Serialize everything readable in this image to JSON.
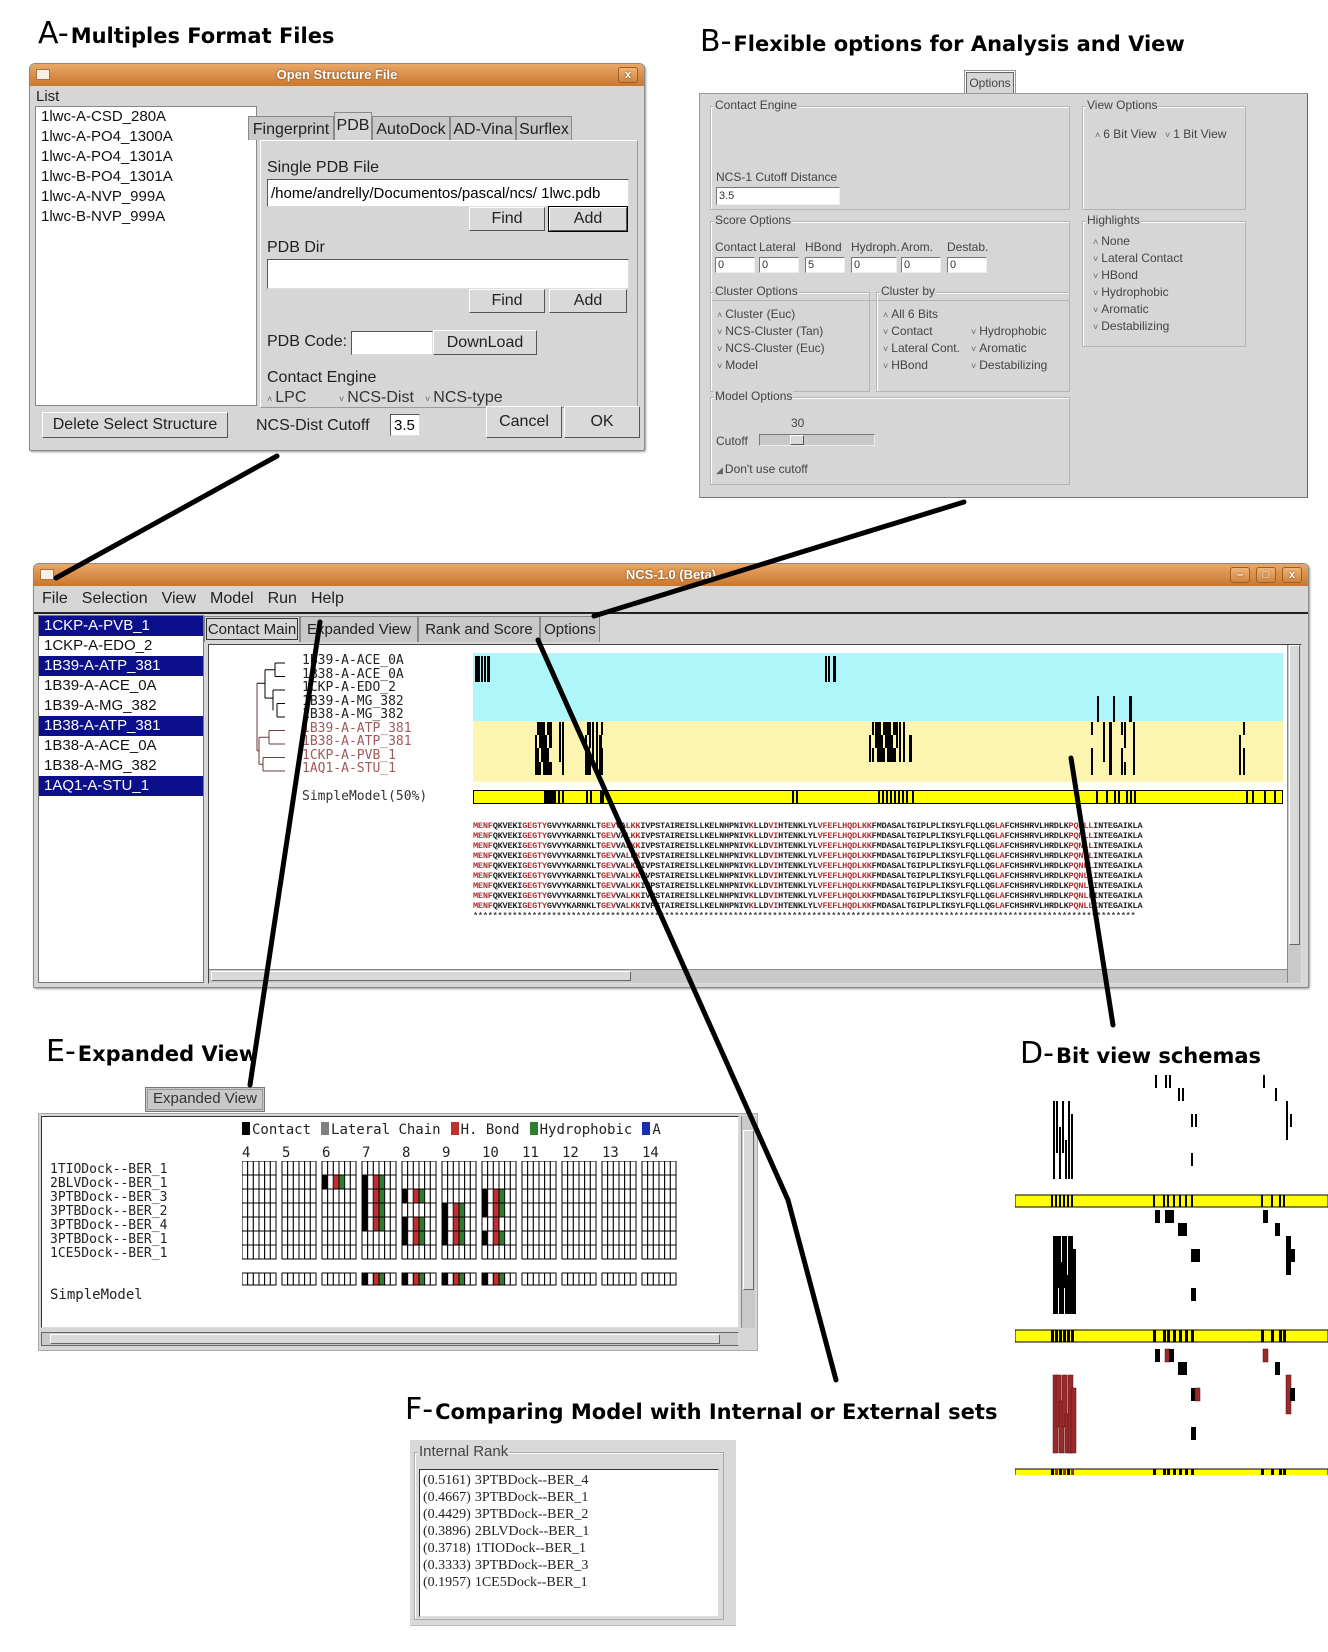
{
  "sections": {
    "A": {
      "letter": "A-",
      "title": "Multiples Format Files"
    },
    "B": {
      "letter": "B-",
      "title": "Flexible options for Analysis and View"
    },
    "D": {
      "letter": "D-",
      "title": "Bit view schemas"
    },
    "E": {
      "letter": "E-",
      "title": "Expanded View"
    },
    "F": {
      "letter": "F-",
      "title": "Comparing Model with Internal or External sets"
    }
  },
  "open_dialog": {
    "title": "Open Structure File",
    "close_glyph": "x",
    "list_label": "List",
    "list_items": [
      "1lwc-A-CSD_280A",
      "1lwc-A-PO4_1300A",
      "1lwc-A-PO4_1301A",
      "1lwc-B-PO4_1301A",
      "1lwc-A-NVP_999A",
      "1lwc-B-NVP_999A"
    ],
    "tabs": [
      {
        "label": "Fingerprint",
        "active": false
      },
      {
        "label": "PDB",
        "active": true
      },
      {
        "label": "AutoDock",
        "active": false
      },
      {
        "label": "AD-Vina",
        "active": false
      },
      {
        "label": "Surflex",
        "active": false
      }
    ],
    "single_pdb_label": "Single PDB File",
    "single_pdb_value": "/home/andrelly/Documentos/pascal/ncs/ 1lwc.pdb",
    "find_label": "Find",
    "add_label": "Add",
    "pdb_dir_label": "PDB Dir",
    "pdb_dir_value": "",
    "pdb_code_label": "PDB Code:",
    "pdb_code_value": "",
    "download_label": "DownLoad",
    "contact_engine_label": "Contact Engine",
    "contact_engine_options": [
      {
        "label": "LPC",
        "selected": true
      },
      {
        "label": "NCS-Dist",
        "selected": false
      },
      {
        "label": "NCS-type",
        "selected": false
      }
    ],
    "delete_label": "Delete Select Structure",
    "cutoff_label": "NCS-Dist Cutoff",
    "cutoff_value": "3.5",
    "cancel_label": "Cancel",
    "ok_label": "OK"
  },
  "options_panel": {
    "tab_label": "Options",
    "contact_engine": {
      "label": "Contact Engine",
      "cutoff_label": "NCS-1 Cutoff Distance",
      "cutoff_value": "3.5"
    },
    "view_options": {
      "label": "View Options",
      "options": [
        {
          "label": "6 Bit View",
          "selected": true
        },
        {
          "label": "1 Bit View",
          "selected": false
        }
      ]
    },
    "score_options": {
      "label": "Score Options",
      "fields": [
        {
          "label": "Contact",
          "value": "0"
        },
        {
          "label": "Lateral",
          "value": "0"
        },
        {
          "label": "HBond",
          "value": "5"
        },
        {
          "label": "Hydroph.",
          "value": "0"
        },
        {
          "label": "Arom.",
          "value": "0"
        },
        {
          "label": "Destab.",
          "value": "0"
        }
      ]
    },
    "highlights": {
      "label": "Highlights",
      "options": [
        {
          "label": "None",
          "selected": true
        },
        {
          "label": "Lateral Contact",
          "selected": false
        },
        {
          "label": "HBond",
          "selected": false
        },
        {
          "label": "Hydrophobic",
          "selected": false
        },
        {
          "label": "Aromatic",
          "selected": false
        },
        {
          "label": "Destabilizing",
          "selected": false
        }
      ]
    },
    "cluster_options": {
      "label": "Cluster Options",
      "options": [
        {
          "label": "Cluster (Euc)",
          "selected": true
        },
        {
          "label": "NCS-Cluster (Tan)",
          "selected": false
        },
        {
          "label": "NCS-Cluster (Euc)",
          "selected": false
        },
        {
          "label": "Model",
          "selected": false
        }
      ]
    },
    "cluster_by": {
      "label": "Cluster by",
      "options": [
        {
          "label": "All 6 Bits",
          "selected": true
        },
        {
          "label": "Contact",
          "selected": false
        },
        {
          "label": "Lateral Cont.",
          "selected": false
        },
        {
          "label": "HBond",
          "selected": false
        },
        {
          "label": "Hydrophobic",
          "selected": false
        },
        {
          "label": "Aromatic",
          "selected": false
        },
        {
          "label": "Destabilizing",
          "selected": false
        }
      ]
    },
    "model_options": {
      "label": "Model Options",
      "cutoff_label": "Cutoff",
      "cutoff_value": 30,
      "cutoff_min": 0,
      "cutoff_max": 100,
      "dont_use_label": "Don't use cutoff",
      "dont_use_checked": false
    }
  },
  "main_window": {
    "title": "NCS-1.0 (Beta)",
    "menu": [
      "File",
      "Selection",
      "View",
      "Model",
      "Run",
      "Help"
    ],
    "structures": [
      {
        "name": "1CKP-A-PVB_1",
        "selected": true
      },
      {
        "name": "1CKP-A-EDO_2",
        "selected": false
      },
      {
        "name": "1B39-A-ATP_381",
        "selected": true
      },
      {
        "name": "1B39-A-ACE_0A",
        "selected": false
      },
      {
        "name": "1B39-A-MG_382",
        "selected": false
      },
      {
        "name": "1B38-A-ATP_381",
        "selected": true
      },
      {
        "name": "1B38-A-ACE_0A",
        "selected": false
      },
      {
        "name": "1B38-A-MG_382",
        "selected": false
      },
      {
        "name": "1AQ1-A-STU_1",
        "selected": true
      }
    ],
    "tabs": [
      {
        "label": "Contact Main",
        "active": true
      },
      {
        "label": "Expanded View",
        "active": false
      },
      {
        "label": "Rank and Score",
        "active": false
      },
      {
        "label": "Options",
        "active": false
      }
    ],
    "cluster_rows": [
      {
        "name": "1B39-A-ACE_0A",
        "cluster": "blue"
      },
      {
        "name": "1B38-A-ACE_0A",
        "cluster": "blue"
      },
      {
        "name": "1CKP-A-EDO_2",
        "cluster": "blue"
      },
      {
        "name": "1B39-A-MG_382",
        "cluster": "blue"
      },
      {
        "name": "1B38-A-MG_382",
        "cluster": "blue"
      },
      {
        "name": "1B39-A-ATP_381",
        "cluster": "yellow"
      },
      {
        "name": "1B38-A-ATP_381",
        "cluster": "yellow"
      },
      {
        "name": "1CKP-A-PVB_1",
        "cluster": "yellow"
      },
      {
        "name": "1AQ1-A-STU_1",
        "cluster": "yellow"
      }
    ],
    "model_label": "SimpleModel(50%)",
    "sequence": "MENFQKVEKIGEGTYGVVYKARNKLTGEVVALKKIVPSTAIREISLLKELNHPNIVKLLDVIHTENKLYLVFEFLHQDLKKFMDASALTGIPLPLIKSYLFQLLQGLAFCHSHRVLHRDLKPQNLLINTEGAIKLA",
    "sequence_rows": 9,
    "conservation": "***************************************************************************************************************************************",
    "cluster_colors": {
      "blue": "#aef6f9",
      "yellow": "#fbf5b0",
      "model": "#ffff00"
    }
  },
  "expanded_view": {
    "tab_label": "Expanded View",
    "legend": [
      {
        "label": "Contact",
        "color": "#000000"
      },
      {
        "label": "Lateral Chain",
        "color": "#808080"
      },
      {
        "label": "H. Bond",
        "color": "#c03030"
      },
      {
        "label": "Hydrophobic",
        "color": "#2e7d32"
      },
      {
        "label": "A",
        "color": "#1a2fb0"
      }
    ],
    "columns": [
      "4",
      "5",
      "6",
      "7",
      "8",
      "9",
      "10",
      "11",
      "12",
      "13",
      "14"
    ],
    "rows": [
      "1TIODock--BER_1",
      "2BLVDock--BER_1",
      "3PTBDock--BER_3",
      "3PTBDock--BER_2",
      "3PTBDock--BER_4",
      "3PTBDock--BER_1",
      "1CE5Dock--BER_1"
    ],
    "model_label": "SimpleModel",
    "bits": {
      "comment_cols": "column index -> list of [row, bitIndex]; bits: 0 contact, 1 lateral, 2 hbond, 3 hydrophobic",
      "6": [
        [
          1,
          0
        ],
        [
          1,
          2
        ],
        [
          1,
          3
        ]
      ],
      "7": [
        [
          1,
          0
        ],
        [
          2,
          0
        ],
        [
          3,
          0
        ],
        [
          4,
          0
        ],
        [
          1,
          2
        ],
        [
          2,
          2
        ],
        [
          3,
          2
        ],
        [
          4,
          2
        ],
        [
          1,
          3
        ],
        [
          2,
          3
        ],
        [
          3,
          3
        ],
        [
          4,
          3
        ]
      ],
      "8": [
        [
          2,
          0
        ],
        [
          2,
          2
        ],
        [
          2,
          3
        ],
        [
          4,
          0
        ],
        [
          4,
          2
        ],
        [
          4,
          3
        ],
        [
          5,
          0
        ],
        [
          5,
          2
        ],
        [
          5,
          3
        ]
      ],
      "9": [
        [
          3,
          0
        ],
        [
          4,
          0
        ],
        [
          5,
          0
        ],
        [
          3,
          2
        ],
        [
          4,
          2
        ],
        [
          5,
          2
        ],
        [
          3,
          3
        ],
        [
          4,
          3
        ],
        [
          5,
          3
        ]
      ],
      "10": [
        [
          2,
          0
        ],
        [
          3,
          0
        ],
        [
          2,
          2
        ],
        [
          3,
          2
        ],
        [
          4,
          2
        ],
        [
          2,
          3
        ],
        [
          3,
          3
        ],
        [
          5,
          0
        ],
        [
          5,
          2
        ],
        [
          5,
          3
        ]
      ]
    },
    "model_bits": {
      "7": [
        0,
        2,
        3
      ],
      "8": [
        0,
        2,
        3
      ],
      "9": [
        0,
        2,
        3
      ],
      "10": [
        0,
        2,
        3
      ]
    }
  },
  "internal_rank": {
    "label": "Internal Rank",
    "items": [
      {
        "score": "(0.5161)",
        "name": "3PTBDock--BER_4"
      },
      {
        "score": "(0.4667)",
        "name": "3PTBDock--BER_1"
      },
      {
        "score": "(0.4429)",
        "name": "3PTBDock--BER_2"
      },
      {
        "score": "(0.3896)",
        "name": "2BLVDock--BER_1"
      },
      {
        "score": "(0.3718)",
        "name": "1TIODock--BER_1"
      },
      {
        "score": "(0.3333)",
        "name": "3PTBDock--BER_3"
      },
      {
        "score": "(0.1957)",
        "name": "1CE5Dock--BER_1"
      }
    ]
  }
}
